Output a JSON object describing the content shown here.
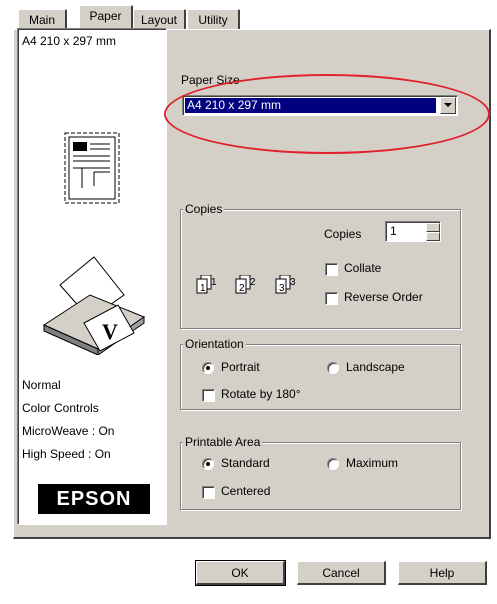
{
  "tabs": [
    "Main",
    "Paper",
    "Layout",
    "Utility"
  ],
  "preview": {
    "paper_label": "A4 210 x 297 mm",
    "settings": [
      "Normal",
      "Color Controls",
      "MicroWeave : On",
      "High Speed : On"
    ],
    "brand": "EPSON"
  },
  "paper_size": {
    "label": "Paper Size",
    "value": "A4 210 x 297 mm"
  },
  "copies": {
    "group_title": "Copies",
    "count_label": "Copies",
    "count": "1",
    "collate_label": "Collate",
    "collate_checked": false,
    "reverse_label": "Reverse Order",
    "reverse_checked": false,
    "icon_labels": [
      "1",
      "1",
      "2",
      "2",
      "3",
      "3"
    ]
  },
  "orientation": {
    "group_title": "Orientation",
    "portrait_label": "Portrait",
    "landscape_label": "Landscape",
    "selected": "Portrait",
    "rotate_label": "Rotate by 180°",
    "rotate_checked": false
  },
  "printable_area": {
    "group_title": "Printable Area",
    "standard_label": "Standard",
    "maximum_label": "Maximum",
    "selected": "Standard",
    "centered_label": "Centered",
    "centered_checked": false
  },
  "buttons": {
    "ok": "OK",
    "cancel": "Cancel",
    "help": "Help"
  },
  "colors": {
    "face": "#d4d0c8",
    "selection": "#000080",
    "highlight_ellipse": "#e0202a"
  }
}
